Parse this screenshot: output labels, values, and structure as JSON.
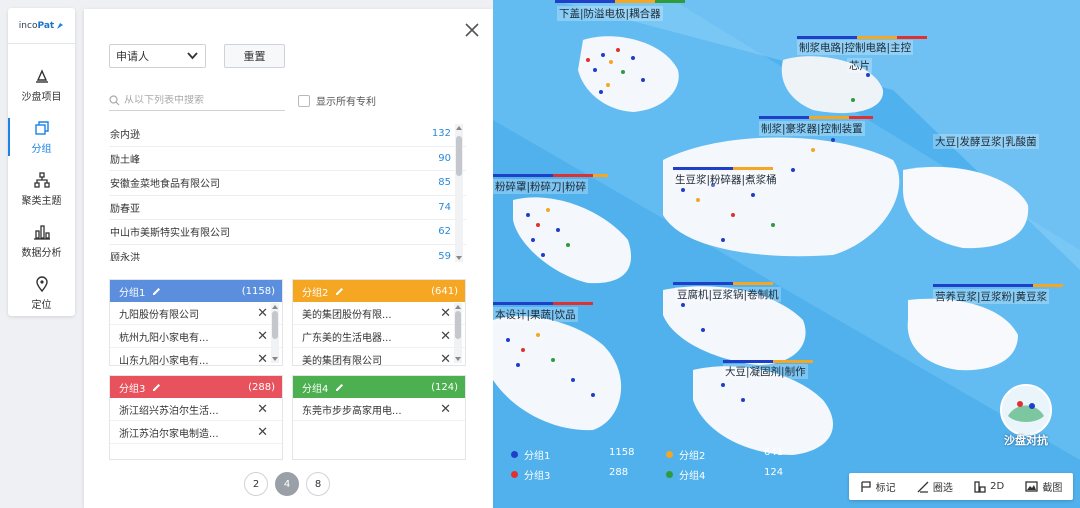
{
  "logo": {
    "prefix": "inco",
    "suffix": "Pat"
  },
  "sidebar": {
    "items": [
      {
        "label": "沙盘项目",
        "icon": "sandbox-icon"
      },
      {
        "label": "分组",
        "icon": "group-icon"
      },
      {
        "label": "聚类主题",
        "icon": "cluster-icon"
      },
      {
        "label": "数据分析",
        "icon": "chart-icon"
      },
      {
        "label": "定位",
        "icon": "location-icon"
      }
    ],
    "active_index": 1
  },
  "panel": {
    "field_select": "申请人",
    "reset_label": "重置",
    "search_placeholder": "从以下列表中搜索",
    "show_all_label": "显示所有专利",
    "list": [
      {
        "name": "余内逊",
        "count": "132"
      },
      {
        "name": "励土峰",
        "count": "90"
      },
      {
        "name": "安徽金菜地食品有限公司",
        "count": "85"
      },
      {
        "name": "励春亚",
        "count": "74"
      },
      {
        "name": "中山市美斯特实业有限公司",
        "count": "62"
      },
      {
        "name": "顾永洪",
        "count": "59"
      }
    ],
    "groups": [
      {
        "name": "分组1",
        "count": "(1158)",
        "color": "#5b8fde",
        "items": [
          "九阳股份有限公司",
          "杭州九阳小家电有...",
          "山东九阳小家电有..."
        ]
      },
      {
        "name": "分组2",
        "count": "(641)",
        "color": "#f5a623",
        "items": [
          "美的集团股份有限...",
          "广东美的生活电器...",
          "美的集团有限公司"
        ]
      },
      {
        "name": "分组3",
        "count": "(288)",
        "color": "#e8525d",
        "items": [
          "浙江绍兴苏泊尔生活...",
          "浙江苏泊尔家电制造..."
        ]
      },
      {
        "name": "分组4",
        "count": "(124)",
        "color": "#4caf50",
        "items": [
          "东莞市步步高家用电..."
        ]
      }
    ],
    "pagination": [
      "2",
      "4",
      "8"
    ],
    "active_page": "4"
  },
  "map": {
    "labels": [
      "下盖|防溢电极|耦合器",
      "制浆电路|控制电路|主控",
      "芯片",
      "制浆|豪浆器|控制装置",
      "大豆|发酵豆浆|乳酸菌",
      "生豆浆|粉碎器|煮浆桶",
      "粉碎罩|粉碎刀|粉碎",
      "豆腐机|豆浆锅|卷制机",
      "营养豆浆|豆浆粉|黄豆浆",
      "本设计|果蔬|饮品",
      "大豆|凝固剂|制作"
    ],
    "legend": [
      {
        "name": "分组1",
        "value": "1158",
        "color": "#1f3fc9"
      },
      {
        "name": "分组2",
        "value": "641",
        "color": "#f5a623"
      },
      {
        "name": "分组3",
        "value": "288",
        "color": "#e0302f"
      },
      {
        "name": "分组4",
        "value": "124",
        "color": "#2e9b3c"
      }
    ],
    "tools": [
      {
        "label": "标记",
        "icon": "flag-icon"
      },
      {
        "label": "圈选",
        "icon": "lasso-icon"
      },
      {
        "label": "2D",
        "icon": "grid-icon"
      },
      {
        "label": "截图",
        "icon": "image-icon"
      }
    ],
    "badge_text": "沙盘对抗"
  }
}
